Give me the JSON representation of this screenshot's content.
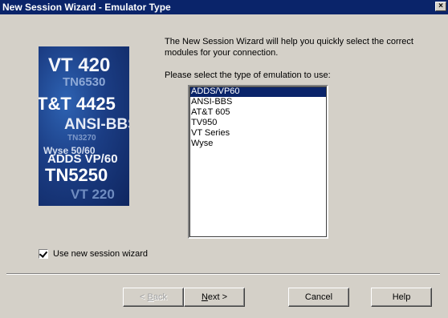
{
  "window": {
    "title": "New Session Wizard - Emulator Type",
    "close_glyph": "×"
  },
  "banner": {
    "lines": [
      "VT 420",
      "TN6530",
      "T&T 4425",
      "ANSI-BBS",
      "TN3270",
      "Wyse 50/60",
      "ADDS VP/60",
      "TN5250",
      "VT 220"
    ]
  },
  "content": {
    "intro": "The New Session Wizard will help you quickly select the correct modules for your connection.",
    "prompt": "Please select the type of emulation to use:",
    "emulation_options": [
      "ADDS/VP60",
      "ANSI-BBS",
      "AT&T 605",
      "TV950",
      "VT Series",
      "Wyse"
    ],
    "selected_option": "ADDS/VP60"
  },
  "options": {
    "use_wizard_label": "Use new session wizard",
    "use_wizard_checked": true
  },
  "buttons": {
    "back_prefix": "< ",
    "back_accel": "B",
    "back_rest": "ack",
    "next_accel": "N",
    "next_rest": "ext >",
    "cancel": "Cancel",
    "help": "Help"
  }
}
